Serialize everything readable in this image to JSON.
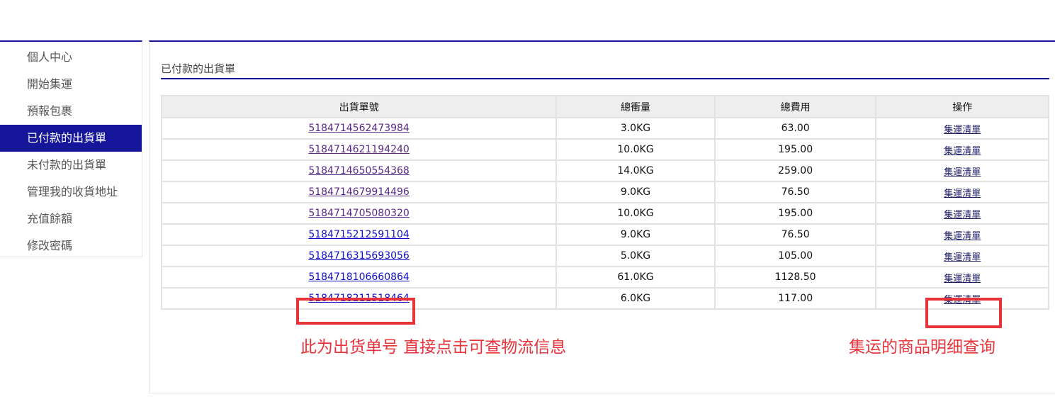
{
  "sidebar": {
    "items": [
      {
        "label": "個人中心",
        "active": false
      },
      {
        "label": "開始集運",
        "active": false
      },
      {
        "label": "預報包裹",
        "active": false
      },
      {
        "label": "已付款的出貨單",
        "active": true
      },
      {
        "label": "未付款的出貨單",
        "active": false
      },
      {
        "label": "管理我的收貨地址",
        "active": false
      },
      {
        "label": "充值餘額",
        "active": false
      },
      {
        "label": "修改密碼",
        "active": false
      }
    ]
  },
  "main": {
    "section_title": "已付款的出貨單",
    "table": {
      "headers": [
        "出貨單號",
        "總衝量",
        "總費用",
        "操作"
      ],
      "rows": [
        {
          "order_no": "5184714562473984",
          "weight": "3.0KG",
          "fee": "63.00",
          "action": "集運清單",
          "visited": true
        },
        {
          "order_no": "5184714621194240",
          "weight": "10.0KG",
          "fee": "195.00",
          "action": "集運清單",
          "visited": true
        },
        {
          "order_no": "5184714650554368",
          "weight": "14.0KG",
          "fee": "259.00",
          "action": "集運清單",
          "visited": true
        },
        {
          "order_no": "5184714679914496",
          "weight": "9.0KG",
          "fee": "76.50",
          "action": "集運清單",
          "visited": true
        },
        {
          "order_no": "5184714705080320",
          "weight": "10.0KG",
          "fee": "195.00",
          "action": "集運清單",
          "visited": true
        },
        {
          "order_no": "5184715212591104",
          "weight": "9.0KG",
          "fee": "76.50",
          "action": "集運清單",
          "visited": false
        },
        {
          "order_no": "5184716315693056",
          "weight": "5.0KG",
          "fee": "105.00",
          "action": "集運清單",
          "visited": false
        },
        {
          "order_no": "5184718106660864",
          "weight": "61.0KG",
          "fee": "1128.50",
          "action": "集運清單",
          "visited": false
        },
        {
          "order_no": "5184718211518464",
          "weight": "6.0KG",
          "fee": "117.00",
          "action": "集運清單",
          "visited": false
        }
      ]
    }
  },
  "annotations": {
    "order_note": "此为出货单号 直接点击可查物流信息",
    "detail_note": "集运的商品明细查询",
    "color": "#e8333a"
  },
  "colors": {
    "accent": "#16169a",
    "visited_link": "#5b2a86",
    "link": "#1010c8"
  }
}
